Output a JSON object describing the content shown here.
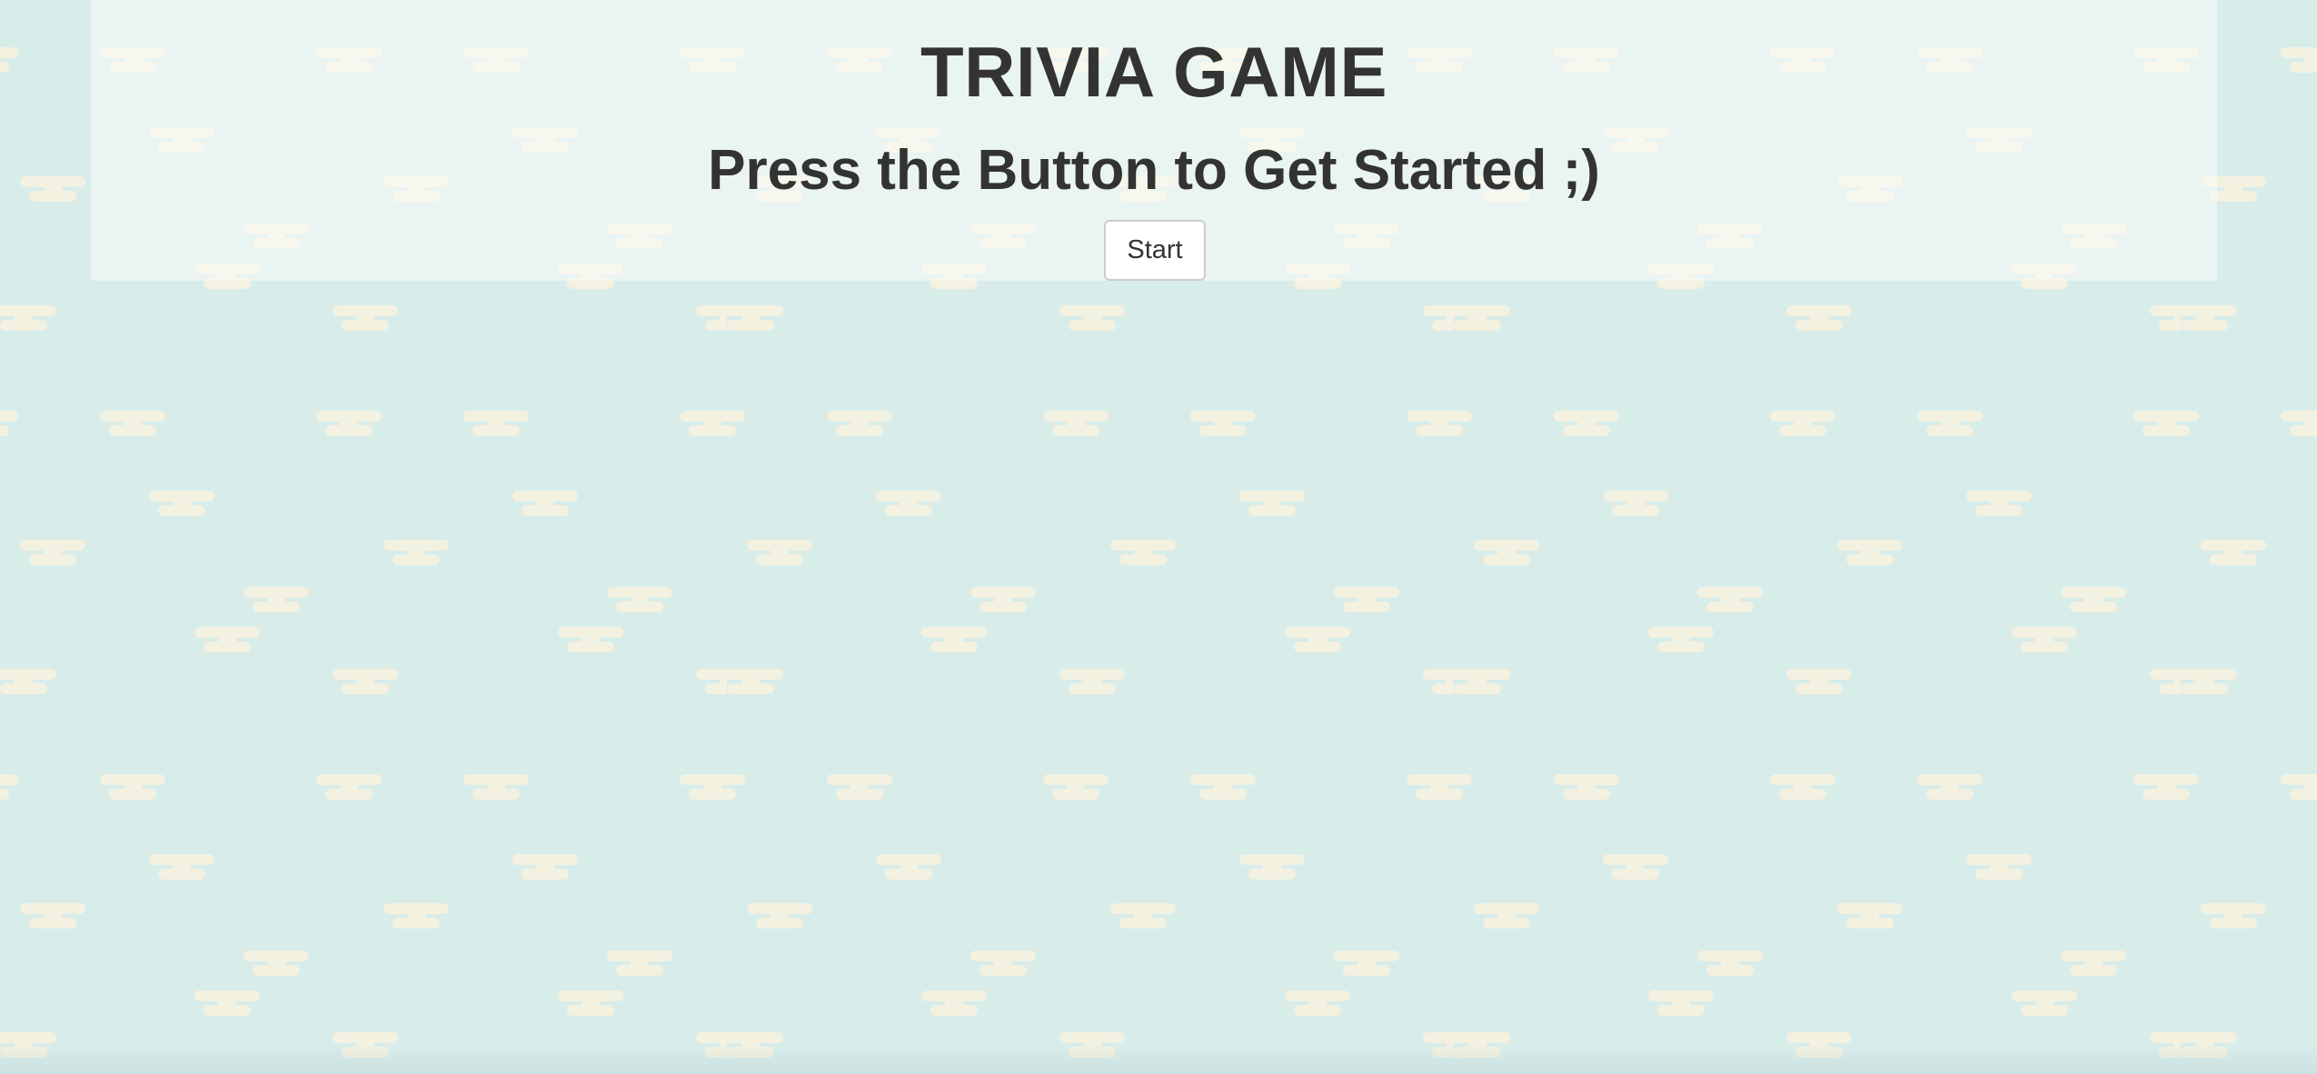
{
  "page": {
    "title": "TRIVIA GAME",
    "subtitle": "Press the Button to Get Started ;)",
    "start_button_label": "Start"
  },
  "colors": {
    "background": "#d8ecea",
    "pattern": "#f3f1e0",
    "panel": "#ecf6f4",
    "text": "#333333",
    "button_border": "#cccccc"
  },
  "background_pattern_icon": "anvil-shape-pattern"
}
